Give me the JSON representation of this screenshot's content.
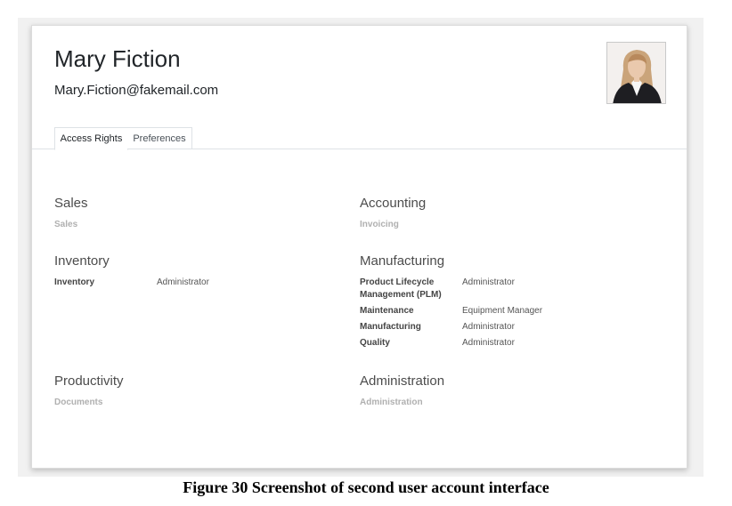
{
  "user": {
    "name": "Mary Fiction",
    "email": "Mary.Fiction@fakemail.com"
  },
  "tabs": [
    {
      "label": "Access Rights",
      "active": true
    },
    {
      "label": "Preferences",
      "active": false
    }
  ],
  "groups": {
    "sales": {
      "title": "Sales",
      "rows": [
        {
          "label": "Sales",
          "value": ""
        }
      ]
    },
    "accounting": {
      "title": "Accounting",
      "rows": [
        {
          "label": "Invoicing",
          "value": ""
        }
      ]
    },
    "inventory": {
      "title": "Inventory",
      "rows": [
        {
          "label": "Inventory",
          "value": "Administrator"
        }
      ]
    },
    "manufacturing": {
      "title": "Manufacturing",
      "rows": [
        {
          "label": "Product Lifecycle Management (PLM)",
          "value": "Administrator"
        },
        {
          "label": "Maintenance",
          "value": "Equipment Manager"
        },
        {
          "label": "Manufacturing",
          "value": "Administrator"
        },
        {
          "label": "Quality",
          "value": "Administrator"
        }
      ]
    },
    "productivity": {
      "title": "Productivity",
      "rows": [
        {
          "label": "Documents",
          "value": ""
        }
      ]
    },
    "administration": {
      "title": "Administration",
      "rows": [
        {
          "label": "Administration",
          "value": ""
        }
      ]
    }
  },
  "caption": "Figure 30 Screenshot of second user account interface",
  "colors": {
    "accent": "#875a7b",
    "muted_label": "#b0b0b0"
  }
}
